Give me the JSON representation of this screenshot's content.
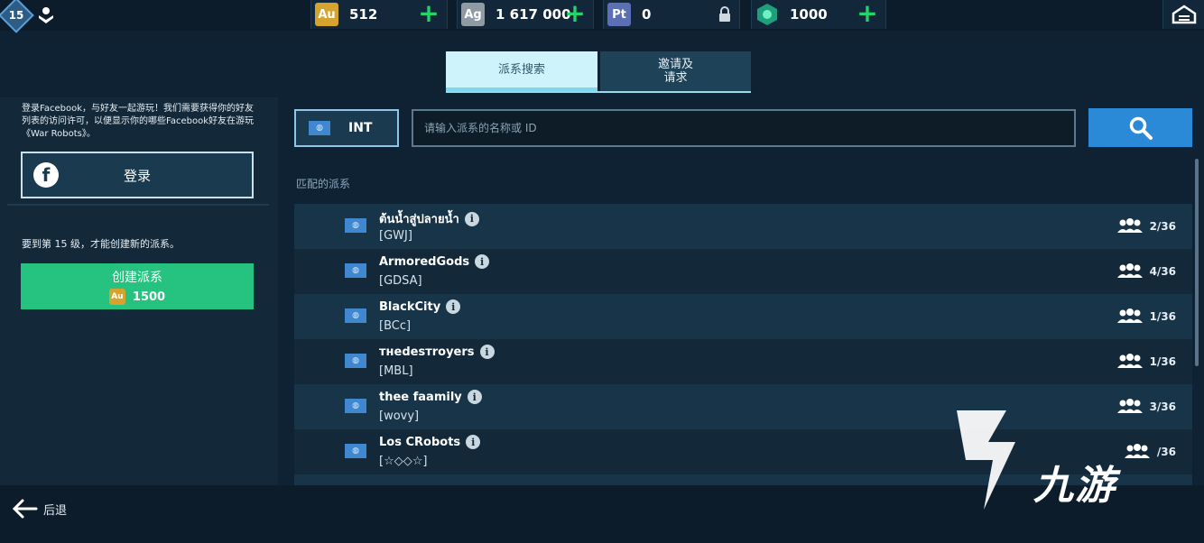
{
  "topbar": {
    "level": "15",
    "currencies": [
      {
        "code": "Au",
        "value": "512",
        "icon_color": "#d4a42e",
        "action": "add"
      },
      {
        "code": "Ag",
        "value": "1 617 000",
        "icon_color": "#8f9aa3",
        "action": "add"
      },
      {
        "code": "Pt",
        "value": "0",
        "icon_color": "#5c6fb5",
        "action": "lock"
      },
      {
        "code": "",
        "value": "1000",
        "icon_color": "#1ea07a",
        "action": "add"
      }
    ]
  },
  "tabs": [
    {
      "label": "派系搜索",
      "active": true
    },
    {
      "label": "邀请及\n请求",
      "active": false
    }
  ],
  "left": {
    "facebook_text": "登录Facebook，与好友一起游玩！我们需要获得你的好友列表的访问许可，以便显示你的哪些Facebook好友在游玩《War Robots》。",
    "login_label": "登录",
    "level_requirement": "要到第 15 级，才能创建新的派系。",
    "create_label": "创建派系",
    "create_cost": "1500",
    "create_cost_code": "Au"
  },
  "search": {
    "region": "INT",
    "placeholder": "请输入派系的名称或 ID"
  },
  "results": {
    "label": "匹配的派系",
    "clans": [
      {
        "name": "ต้นน้ำสู่ปลายน้ำ",
        "tag": "[GWJ]",
        "members": "2/36"
      },
      {
        "name": "ArmoredGods",
        "tag": "[GDSA]",
        "members": "4/36"
      },
      {
        "name": "BlackCity",
        "tag": "[BCc]",
        "members": "1/36"
      },
      {
        "name": "тнedesтroyers",
        "tag": "[MBL]",
        "members": "1/36"
      },
      {
        "name": "thee faamily",
        "tag": "[wovy]",
        "members": "3/36"
      },
      {
        "name": "Los CRobots",
        "tag": "[☆◇◇☆]",
        "members": "/36"
      }
    ]
  },
  "bottom": {
    "back_label": "后退"
  },
  "watermark": {
    "text": "九游"
  }
}
